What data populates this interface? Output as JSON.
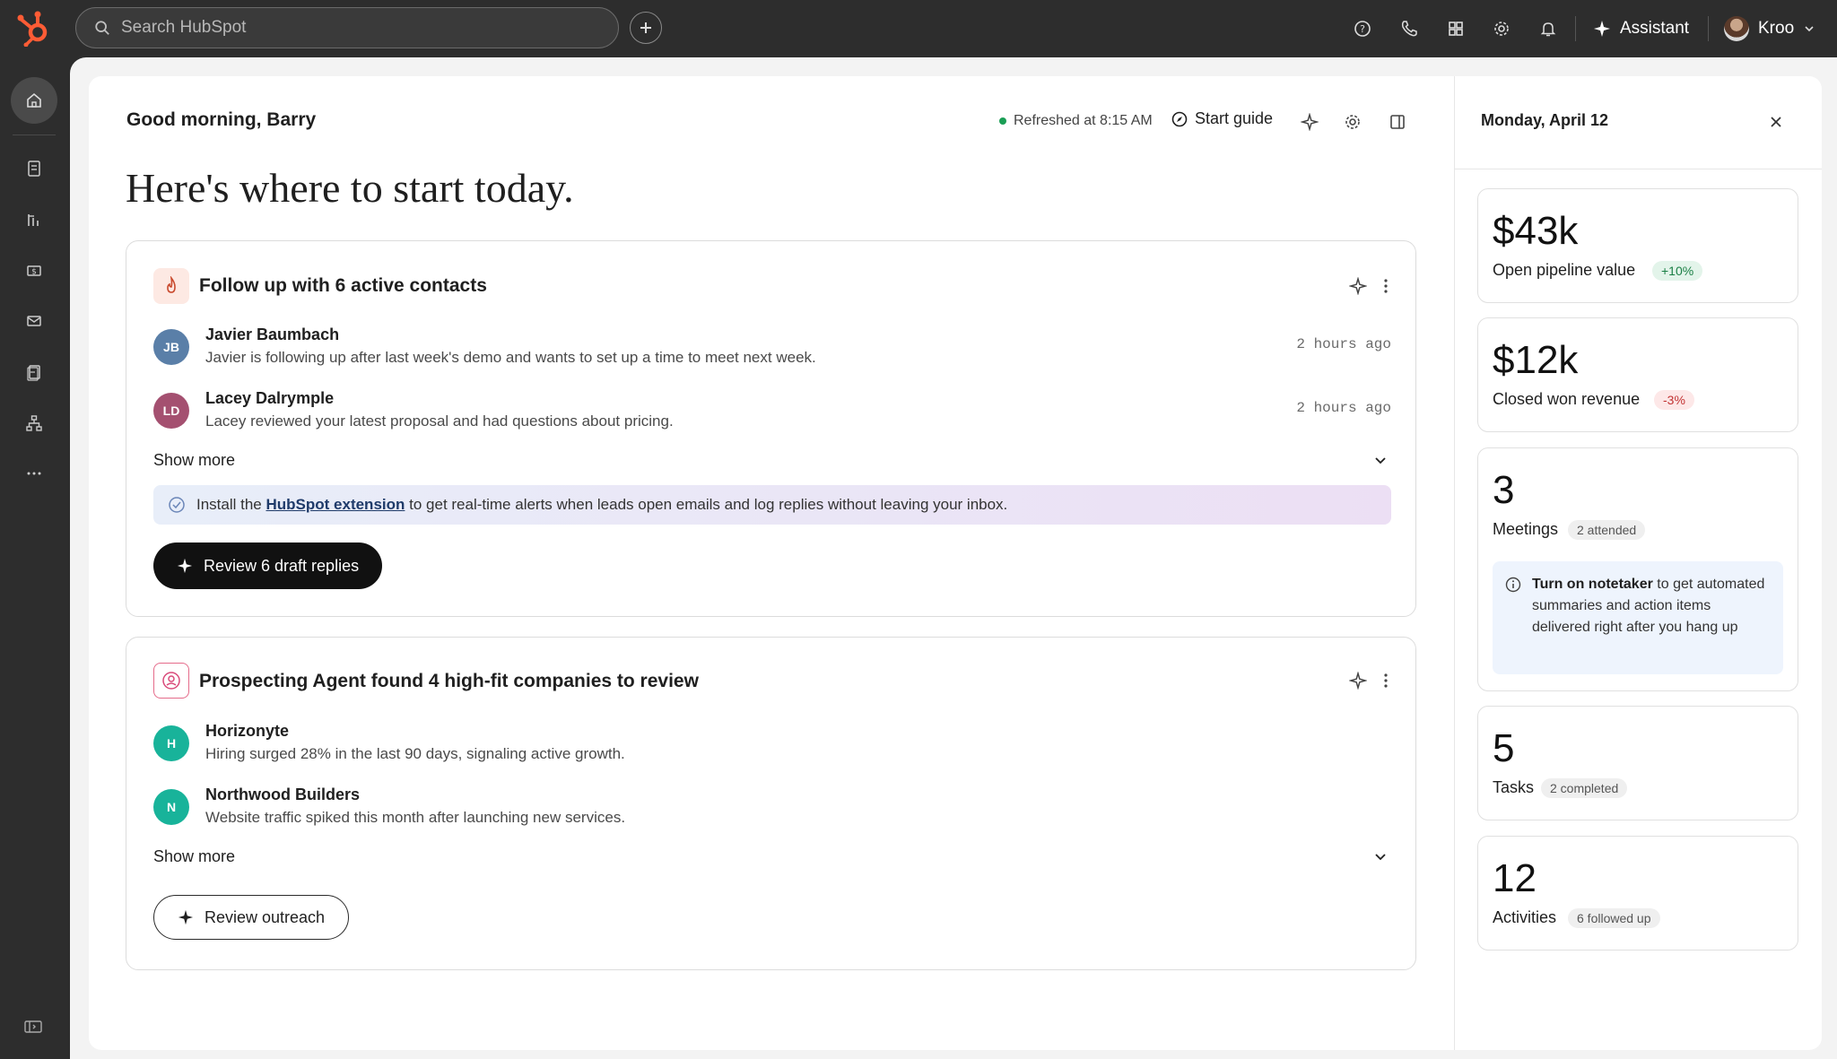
{
  "topbar": {
    "search_placeholder": "Search HubSpot",
    "assistant_label": "Assistant",
    "user_name": "Kroo"
  },
  "header": {
    "greeting": "Good morning, Barry",
    "refresh_status": "Refreshed at 8:15 AM",
    "start_guide_label": "Start guide",
    "headline": "Here's where to start today."
  },
  "cards": {
    "contacts": {
      "title": "Follow up with 6 active contacts",
      "items": [
        {
          "initials": "JB",
          "name": "Javier Baumbach",
          "desc": "Javier is following up after last week's demo and wants to set up a time to meet next week.",
          "time": "2 hours ago",
          "color": "#5a7fa8"
        },
        {
          "initials": "LD",
          "name": "Lacey Dalrymple",
          "desc": "Lacey reviewed your latest proposal and had questions about pricing.",
          "time": "2 hours ago",
          "color": "#a45070"
        }
      ],
      "show_more": "Show more",
      "banner_pre": "Install the ",
      "banner_link": "HubSpot extension",
      "banner_post": " to get real-time alerts when leads open emails and log replies without leaving your inbox.",
      "button_label": "Review 6 draft replies"
    },
    "prospecting": {
      "title": "Prospecting Agent found 4 high-fit companies to review",
      "items": [
        {
          "initials": "H",
          "name": "Horizonyte",
          "desc": "Hiring surged 28% in the last 90 days, signaling active growth.",
          "color": "#18b39a"
        },
        {
          "initials": "N",
          "name": "Northwood Builders",
          "desc": "Website traffic spiked this month after launching new services.",
          "color": "#18b39a"
        }
      ],
      "show_more": "Show more",
      "button_label": "Review outreach"
    }
  },
  "side": {
    "date": "Monday, April 12",
    "metrics": [
      {
        "value": "$43k",
        "label": "Open pipeline value",
        "pill": "+10%",
        "pill_type": "pos"
      },
      {
        "value": "$12k",
        "label": "Closed won revenue",
        "pill": "-3%",
        "pill_type": "neg"
      },
      {
        "value": "3",
        "label": "Meetings",
        "pill": "2 attended",
        "pill_type": "gray"
      },
      {
        "value": "5",
        "label": "Tasks",
        "pill": "2 completed",
        "pill_type": "gray"
      },
      {
        "value": "12",
        "label": "Activities",
        "pill": "6 followed up",
        "pill_type": "gray"
      }
    ],
    "note_bold": "Turn on notetaker",
    "note_rest": " to get automated summaries and action items delivered right after you hang up"
  },
  "colors": {
    "brand": "#ff5c35",
    "topbar": "#2d2d2d",
    "positive": "#1a7f45",
    "negative": "#c23333"
  }
}
